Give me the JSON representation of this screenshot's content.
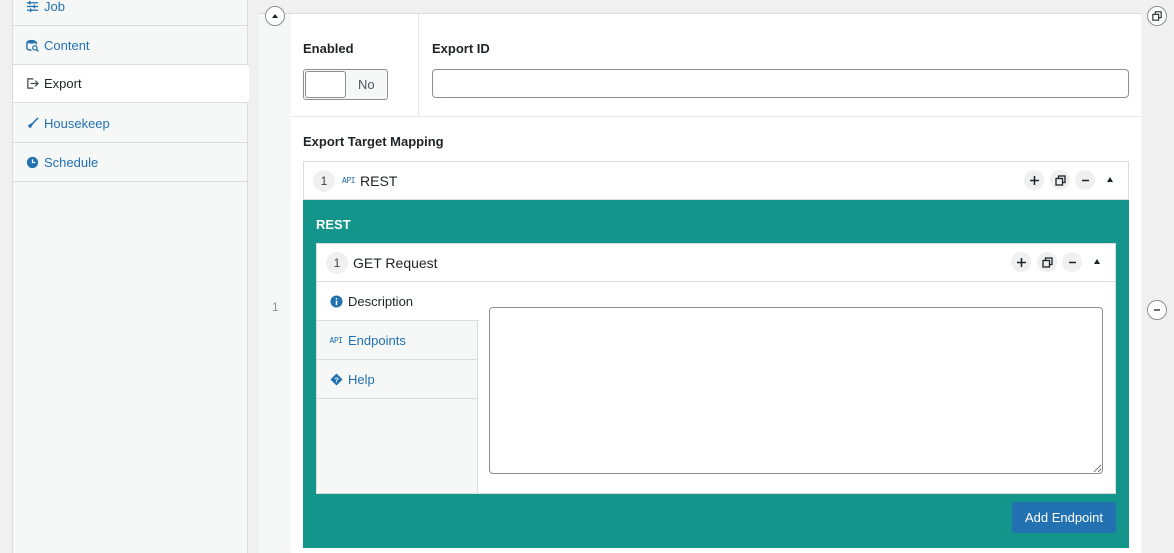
{
  "sidebar": {
    "items": [
      {
        "label": "Job",
        "icon": "sliders-icon"
      },
      {
        "label": "Content",
        "icon": "database-search-icon"
      },
      {
        "label": "Export",
        "icon": "export-icon"
      },
      {
        "label": "Housekeep",
        "icon": "broom-icon"
      },
      {
        "label": "Schedule",
        "icon": "clock-icon"
      }
    ]
  },
  "row": {
    "index": "1"
  },
  "fields": {
    "enabled_label": "Enabled",
    "toggle_text": "No",
    "export_id_label": "Export ID",
    "export_id_value": ""
  },
  "mapping": {
    "label": "Export Target Mapping",
    "item": {
      "number": "1",
      "tag": "API",
      "title": "REST"
    },
    "section_title": "REST"
  },
  "request": {
    "number": "1",
    "title": "GET Request",
    "tabs": [
      {
        "label": "Description",
        "icon": "info-icon"
      },
      {
        "label": "Endpoints",
        "icon": "api-icon",
        "tag": "API"
      },
      {
        "label": "Help",
        "icon": "help-diamond-icon"
      }
    ],
    "description_value": "",
    "add_button": "Add Endpoint"
  },
  "colors": {
    "accent": "#13958b",
    "link": "#2271b1",
    "button": "#2271b1"
  }
}
